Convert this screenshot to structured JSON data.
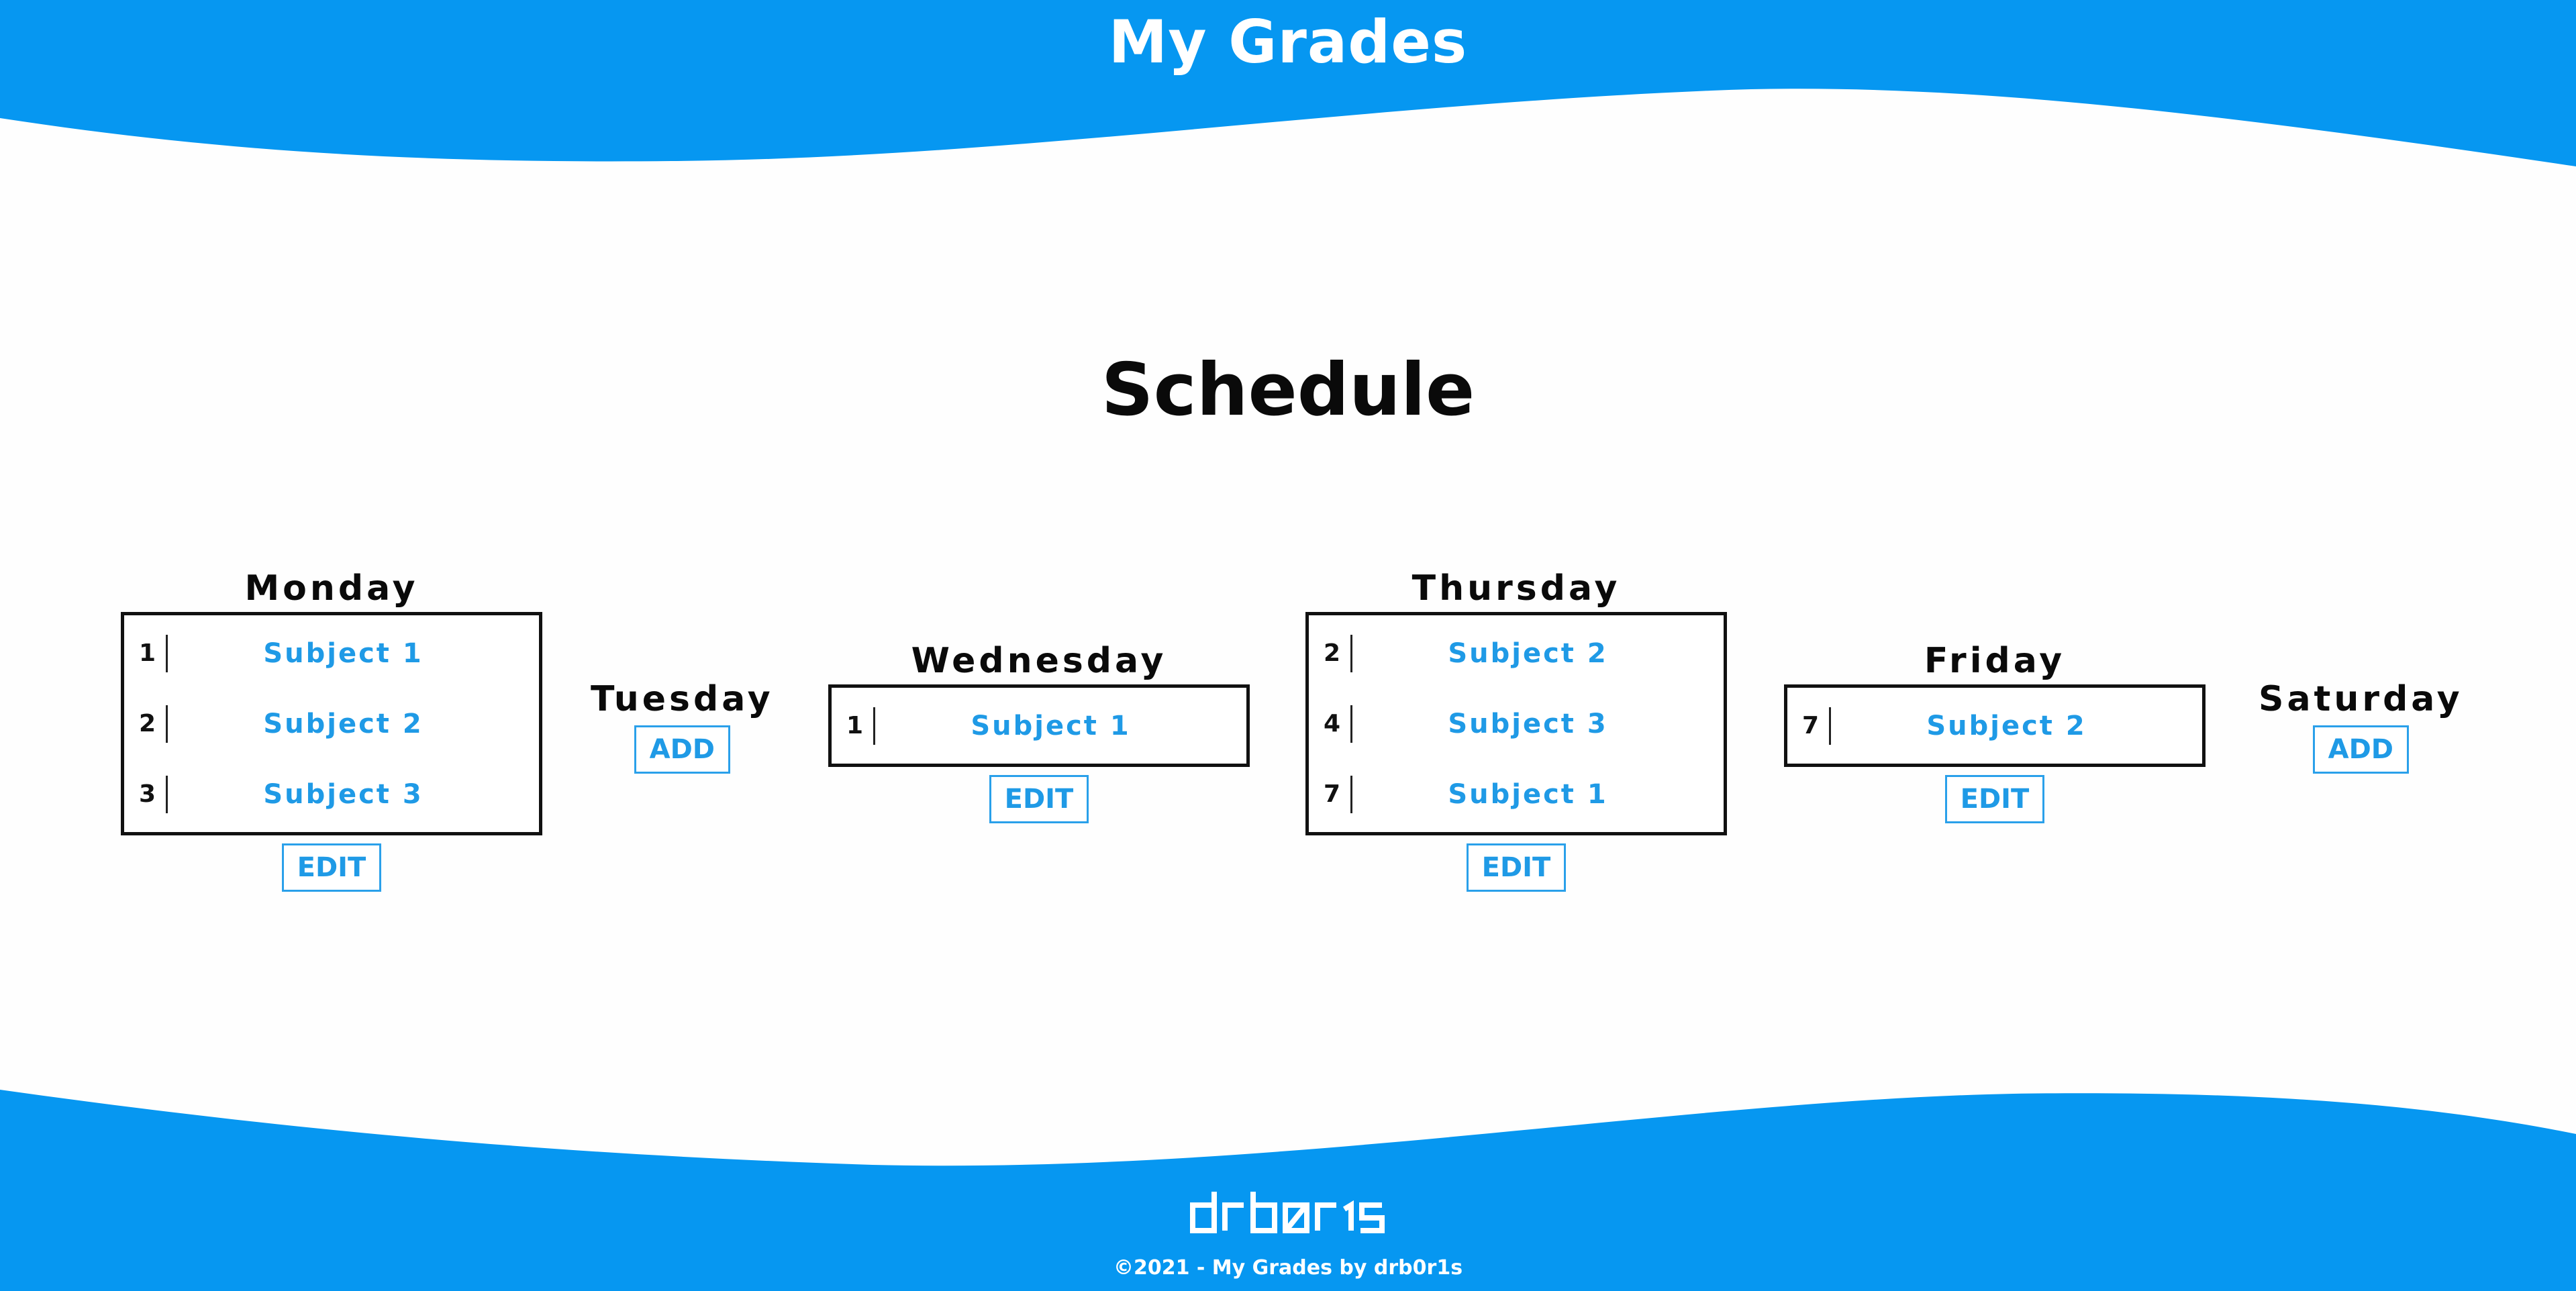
{
  "header": {
    "title": "My Grades"
  },
  "main": {
    "title": "Schedule",
    "days": [
      {
        "name": "Monday",
        "lessons": [
          {
            "num": "1",
            "subject": "Subject 1"
          },
          {
            "num": "2",
            "subject": "Subject 2"
          },
          {
            "num": "3",
            "subject": "Subject 3"
          }
        ],
        "action": "EDIT"
      },
      {
        "name": "Tuesday",
        "lessons": [],
        "action": "ADD"
      },
      {
        "name": "Wednesday",
        "lessons": [
          {
            "num": "1",
            "subject": "Subject 1"
          }
        ],
        "action": "EDIT"
      },
      {
        "name": "Thursday",
        "lessons": [
          {
            "num": "2",
            "subject": "Subject 2"
          },
          {
            "num": "4",
            "subject": "Subject 3"
          },
          {
            "num": "7",
            "subject": "Subject 1"
          }
        ],
        "action": "EDIT"
      },
      {
        "name": "Friday",
        "lessons": [
          {
            "num": "7",
            "subject": "Subject 2"
          }
        ],
        "action": "EDIT"
      },
      {
        "name": "Saturday",
        "lessons": [],
        "action": "ADD"
      }
    ]
  },
  "footer": {
    "logo": "drb0r1s",
    "copyright": "©2021 - My Grades by drb0r1s"
  },
  "colors": {
    "brand_blue": "#0697f1",
    "link_blue": "#1f9ae6",
    "background": "#fefefe"
  }
}
